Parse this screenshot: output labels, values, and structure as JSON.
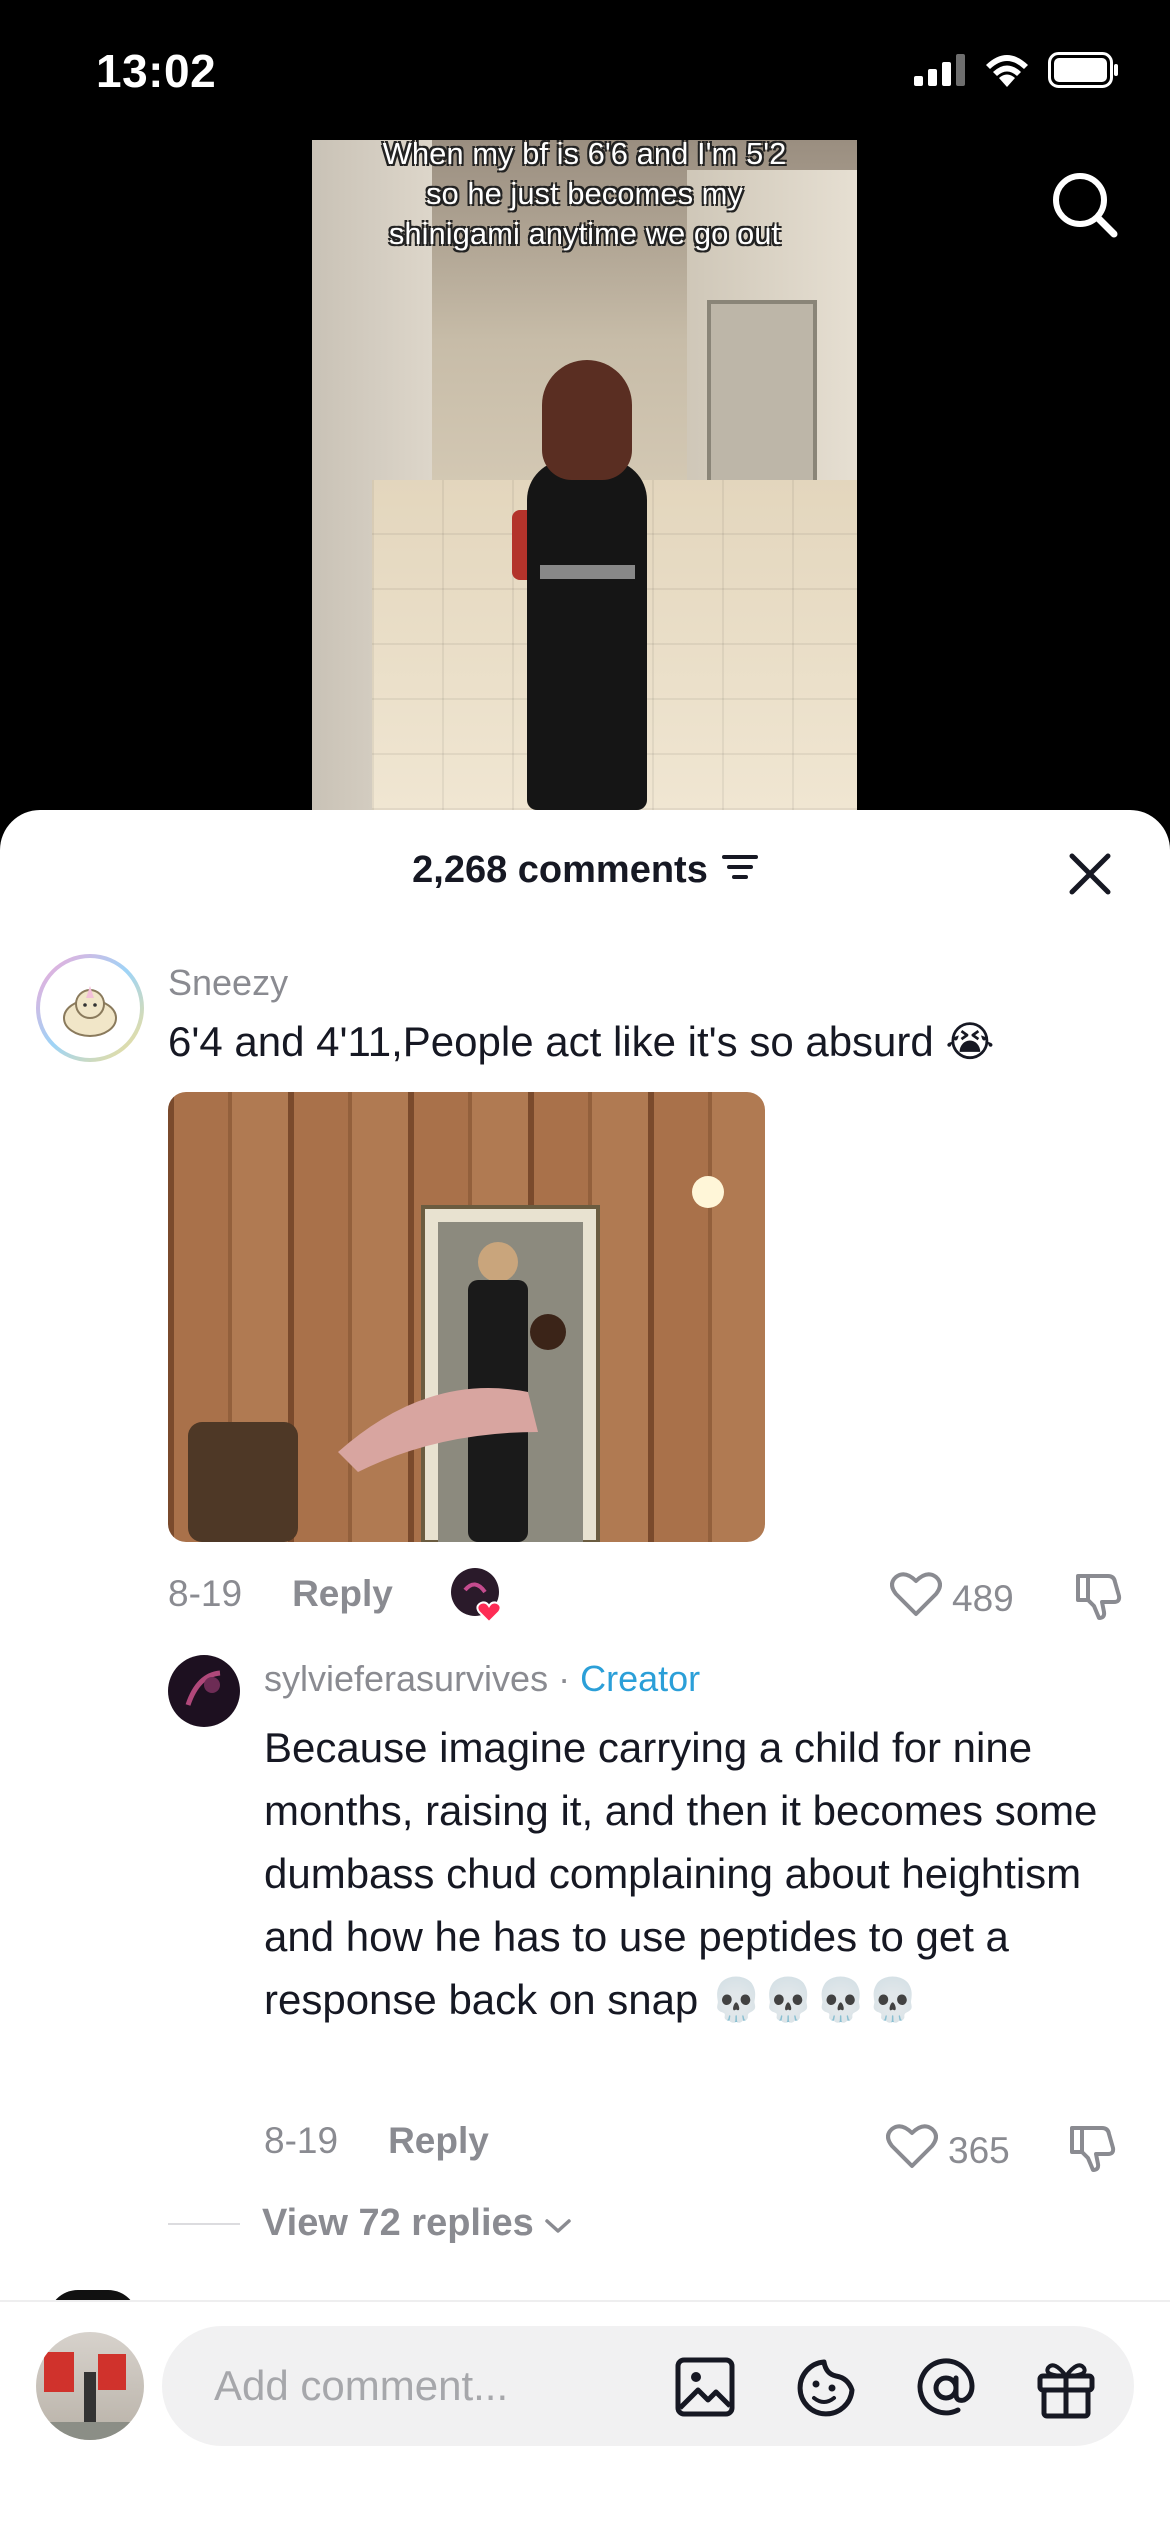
{
  "status_bar": {
    "time": "13:02"
  },
  "video": {
    "caption": "When my bf is 6'6 and I'm 5'2 so he just becomes my shinigami anytime we go out"
  },
  "sheet": {
    "comments_count": "2,268 comments"
  },
  "comments": [
    {
      "username": "Sneezy",
      "text": "6'4 and 4'11,People act like it's so absurd 😭",
      "date": "8-19",
      "reply_label": "Reply",
      "likes": "489"
    }
  ],
  "reply": {
    "username": "sylvieferasurvives",
    "separator": " · ",
    "badge": "Creator",
    "text": "Because imagine carrying a child for nine months, raising it, and then it becomes some dumbass chud complaining about heightism and how he has to use peptides to get a response back on snap 💀💀💀💀",
    "date": "8-19",
    "reply_label": "Reply",
    "likes": "365"
  },
  "view_replies": "View 72 replies",
  "composer": {
    "placeholder": "Add comment..."
  },
  "icons": [
    "signal-icon",
    "wifi-icon",
    "battery-icon",
    "search-icon",
    "filter-icon",
    "close-icon",
    "heart-icon",
    "dislike-icon",
    "chevron-down-icon",
    "image-icon",
    "sticker-icon",
    "mention-icon",
    "gift-icon"
  ],
  "colors": {
    "creator_badge": "#2b9fd8",
    "text_primary": "#161823",
    "text_secondary": "#8a8b91",
    "input_bg": "#f1f1f2",
    "like_heart_badge": "#fe2c55"
  }
}
